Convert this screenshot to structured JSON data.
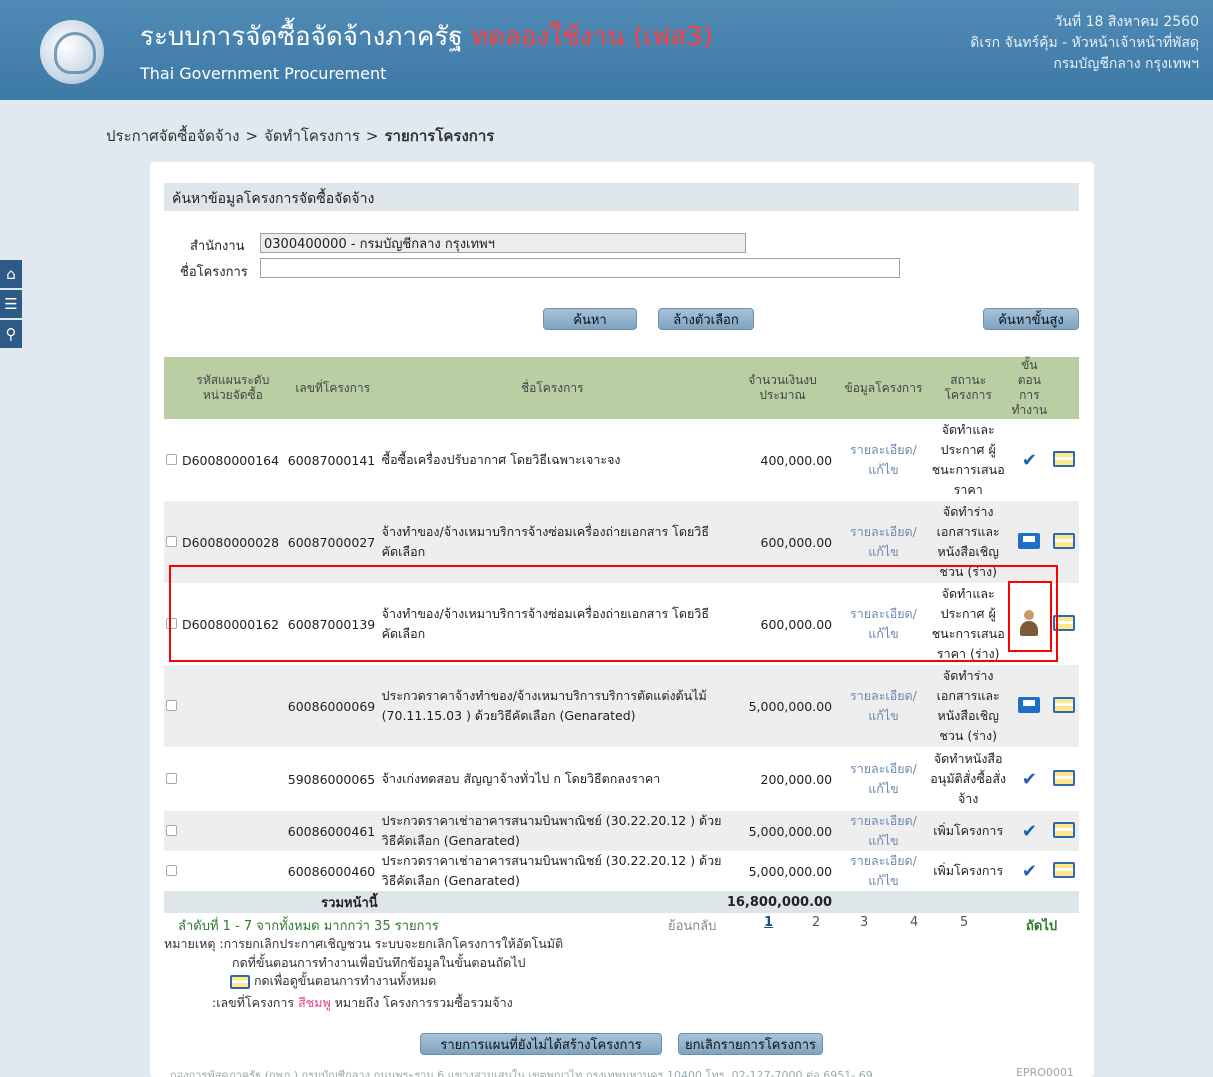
{
  "header": {
    "title": "ระบบการจัดซื้อจัดจ้างภาครัฐ",
    "title_highlight": "ทดลองใช้งาน (เฟส3)",
    "subtitle": "Thai Government Procurement",
    "date": "วันที่ 18 สิงหาคม 2560",
    "user": "ดิเรก จันทร์คุ้ม - หัวหน้าเจ้าหน้าที่พัสดุ",
    "org": "กรมบัญชีกลาง กรุงเทพฯ"
  },
  "breadcrumb": {
    "item1": "ประกาศจัดซื้อจัดจ้าง",
    "sep": ">",
    "item2": "จัดทำโครงการ",
    "current": "รายการโครงการ"
  },
  "search": {
    "panel_title": "ค้นหาข้อมูลโครงการจัดซื้อจัดจ้าง",
    "office_label": "สำนักงาน",
    "office_value": "0300400000 - กรมบัญชีกลาง กรุงเทพฯ",
    "project_label": "ชื่อโครงการ",
    "project_value": "",
    "search_button": "ค้นหา",
    "clear_button": "ล้างตัวเลือก",
    "advanced_button": "ค้นหาขั้นสูง"
  },
  "table": {
    "headers": {
      "plan_code": "รหัสแผนระดับหน่วยจัดซื้อ",
      "project_no": "เลขที่โครงการ",
      "project_name": "ชื่อโครงการ",
      "budget": "จำนวนเงินงบประมาณ",
      "info": "ข้อมูลโครงการ",
      "status": "สถานะโครงการ",
      "step": "ขั้นตอนการทำงาน"
    },
    "rows": [
      {
        "plan_code": "D60080000164",
        "project_no": "60087000141",
        "name": "ซื้อซื้อเครื่องปรับอากาศ โดยวิธีเฉพาะเจาะจง",
        "budget": "400,000.00",
        "info": "รายละเอียด/แก้ไข",
        "status": "จัดทำและประกาศ ผู้ชนะการเสนอราคา",
        "step_icon": "check-icon"
      },
      {
        "plan_code": "D60080000028",
        "project_no": "60087000027",
        "name": "จ้างทำของ/จ้างเหมาบริการจ้างซ่อมเครื่องถ่ายเอกสาร โดยวิธีคัดเลือก",
        "budget": "600,000.00",
        "info": "รายละเอียด/แก้ไข",
        "status": "จัดทำร่างเอกสารและหนังสือเชิญชวน (ร่าง)",
        "step_icon": "document-icon"
      },
      {
        "plan_code": "D60080000162",
        "project_no": "60087000139",
        "name": "จ้างทำของ/จ้างเหมาบริการจ้างซ่อมเครื่องถ่ายเอกสาร โดยวิธีคัดเลือก",
        "budget": "600,000.00",
        "info": "รายละเอียด/แก้ไข",
        "status": "จัดทำและประกาศ ผู้ชนะการเสนอราคา (ร่าง)",
        "step_icon": "person-icon"
      },
      {
        "plan_code": "",
        "project_no": "60086000069",
        "name": "ประกวดราคาจ้างทำของ/จ้างเหมาบริการบริการตัดแต่งต้นไม้ (70.11.15.03 ) ด้วยวิธีคัดเลือก (Genarated)",
        "budget": "5,000,000.00",
        "info": "รายละเอียด/แก้ไข",
        "status": "จัดทำร่างเอกสารและหนังสือเชิญชวน (ร่าง)",
        "step_icon": "document-icon"
      },
      {
        "plan_code": "",
        "project_no": "59086000065",
        "name": "จ้างเก่งทดสอบ สัญญาจ้างทั่วไป ก โดยวิธีตกลงราคา",
        "budget": "200,000.00",
        "info": "รายละเอียด/แก้ไข",
        "status": "จัดทำหนังสืออนุมัติสั่งซื้อสั่งจ้าง",
        "step_icon": "check-icon"
      },
      {
        "plan_code": "",
        "project_no": "60086000461",
        "name": "ประกวดราคาเช่าอาคารสนามบินพาณิชย์ (30.22.20.12 ) ด้วยวิธีคัดเลือก (Genarated)",
        "budget": "5,000,000.00",
        "info": "รายละเอียด/แก้ไข",
        "status": "เพิ่มโครงการ",
        "step_icon": "check-icon"
      },
      {
        "plan_code": "",
        "project_no": "60086000460",
        "name": "ประกวดราคาเช่าอาคารสนามบินพาณิชย์ (30.22.20.12 ) ด้วยวิธีคัดเลือก (Genarated)",
        "budget": "5,000,000.00",
        "info": "รายละเอียด/แก้ไข",
        "status": "เพิ่มโครงการ",
        "step_icon": "check-icon"
      }
    ],
    "total_label": "รวมหน้านี้",
    "total_value": "16,800,000.00"
  },
  "pager": {
    "summary": "ลำดับที่ 1 - 7 จากทั้งหมด มากกว่า 35 รายการ",
    "prev": "ย้อนกลับ",
    "pages": [
      "1",
      "2",
      "3",
      "4",
      "5"
    ],
    "next": "ถัดไป"
  },
  "notes": {
    "line1": "หมายเหตุ :การยกเลิกประกาศเชิญชวน ระบบจะยกเลิกโครงการให้อัตโนมัติ",
    "line2": "กดที่ขั้นตอนการทำงานเพื่อบันทึกข้อมูลในขั้นตอนถัดไป",
    "line3": "กดเพื่อดูขั้นตอนการทำงานทั้งหมด",
    "line4_prefix": ":เลขที่โครงการ",
    "line4_pink": "สีชมพู",
    "line4_suffix": "หมายถึง โครงการรวมซื้อรวมจ้าง"
  },
  "actions": {
    "unplanned_button": "รายการแผนที่ยังไม่ได้สร้างโครงการ",
    "cancel_button": "ยกเลิกรายการโครงการ"
  },
  "footer": {
    "text": "กองการพัสดุภาครัฐ (กพภ.) กรมบัญชีกลาง ถนนพระราม 6 แขวงสามเสนใน เขตพญาไท กรุงเทพมหานคร 10400 โทร. 02-127-7000 ต่อ 6951- 69",
    "code": "EPRO0001"
  }
}
